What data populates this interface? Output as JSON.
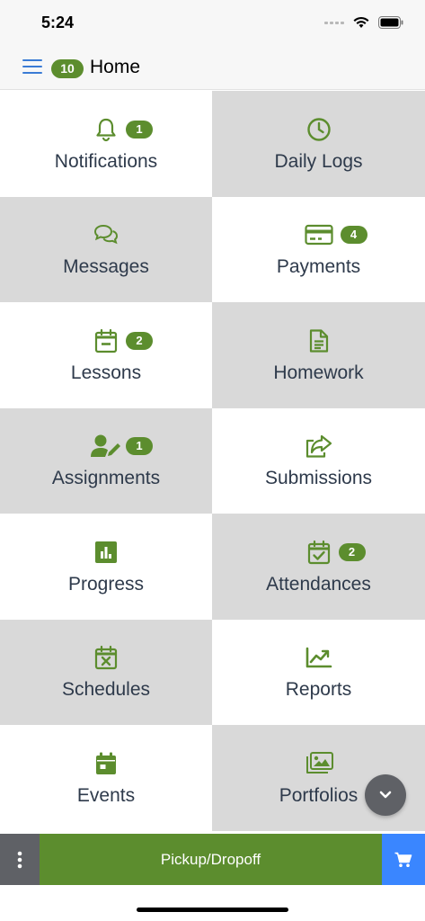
{
  "status_bar": {
    "time": "5:24"
  },
  "header": {
    "badge": "10",
    "title": "Home"
  },
  "tiles": [
    {
      "label": "Notifications",
      "icon": "bell-icon",
      "badge": "1"
    },
    {
      "label": "Daily Logs",
      "icon": "clock-icon",
      "badge": ""
    },
    {
      "label": "Messages",
      "icon": "chat-bubbles-icon",
      "badge": ""
    },
    {
      "label": "Payments",
      "icon": "credit-card-icon",
      "badge": "4"
    },
    {
      "label": "Lessons",
      "icon": "calendar-minus-icon",
      "badge": "2"
    },
    {
      "label": "Homework",
      "icon": "document-icon",
      "badge": ""
    },
    {
      "label": "Assignments",
      "icon": "user-edit-icon",
      "badge": "1"
    },
    {
      "label": "Submissions",
      "icon": "share-icon",
      "badge": ""
    },
    {
      "label": "Progress",
      "icon": "bar-chart-icon",
      "badge": ""
    },
    {
      "label": "Attendances",
      "icon": "calendar-check-icon",
      "badge": "2"
    },
    {
      "label": "Schedules",
      "icon": "calendar-x-icon",
      "badge": ""
    },
    {
      "label": "Reports",
      "icon": "trend-chart-icon",
      "badge": ""
    },
    {
      "label": "Events",
      "icon": "calendar-icon",
      "badge": ""
    },
    {
      "label": "Portfolios",
      "icon": "images-icon",
      "badge": ""
    }
  ],
  "bottom_bar": {
    "pickup_label": "Pickup/Dropoff"
  },
  "colors": {
    "accent_green": "#5c8d2e",
    "tile_gray": "#d9d9d9",
    "menu_blue": "#3a7bd5",
    "cart_blue": "#3a86ff"
  }
}
